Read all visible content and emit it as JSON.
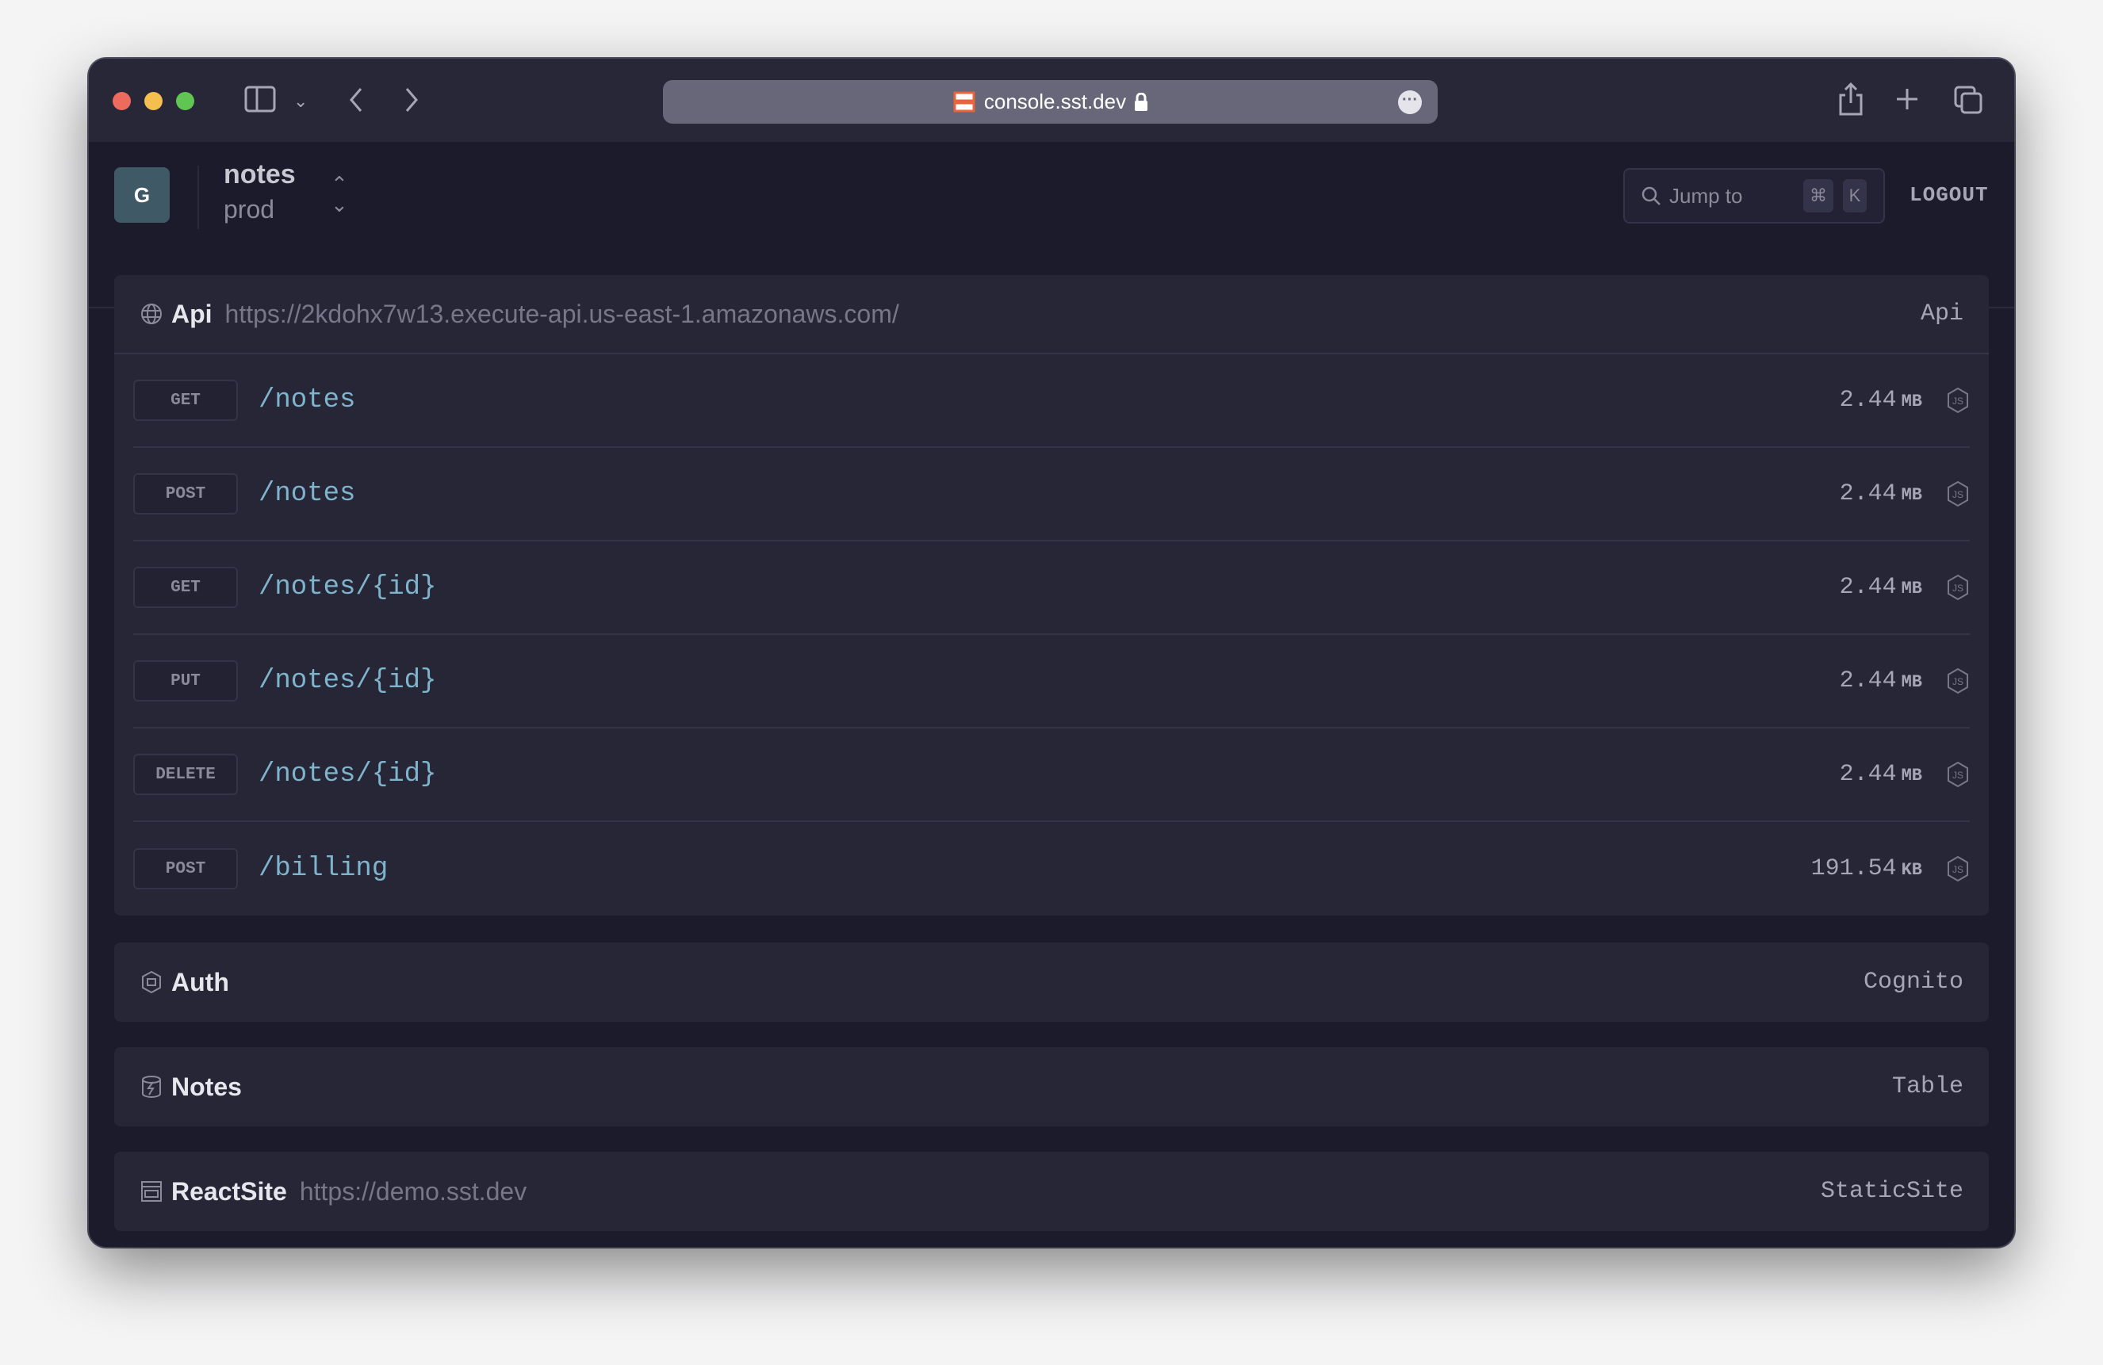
{
  "browser": {
    "url": "console.sst.dev",
    "colors": {
      "close": "#ed6a5e",
      "minimize": "#f5bf4f",
      "maximize": "#61c554"
    }
  },
  "header": {
    "avatar_letter": "G",
    "app": "notes",
    "stage": "prod",
    "jump_placeholder": "Jump to",
    "shortcut_cmd": "⌘",
    "shortcut_key": "K",
    "logout": "LOGOUT"
  },
  "api": {
    "title": "Api",
    "url": "https://2kdohx7w13.execute-api.us-east-1.amazonaws.com/",
    "type": "Api",
    "routes": [
      {
        "method": "GET",
        "path": "/notes",
        "size": "2.44",
        "unit": "MB"
      },
      {
        "method": "POST",
        "path": "/notes",
        "size": "2.44",
        "unit": "MB"
      },
      {
        "method": "GET",
        "path": "/notes/{id}",
        "size": "2.44",
        "unit": "MB"
      },
      {
        "method": "PUT",
        "path": "/notes/{id}",
        "size": "2.44",
        "unit": "MB"
      },
      {
        "method": "DELETE",
        "path": "/notes/{id}",
        "size": "2.44",
        "unit": "MB"
      },
      {
        "method": "POST",
        "path": "/billing",
        "size": "191.54",
        "unit": "KB"
      }
    ]
  },
  "auth": {
    "title": "Auth",
    "type": "Cognito"
  },
  "notes": {
    "title": "Notes",
    "type": "Table"
  },
  "site": {
    "title": "ReactSite",
    "url": "https://demo.sst.dev",
    "type": "StaticSite"
  },
  "accent": "#7eb4cc"
}
